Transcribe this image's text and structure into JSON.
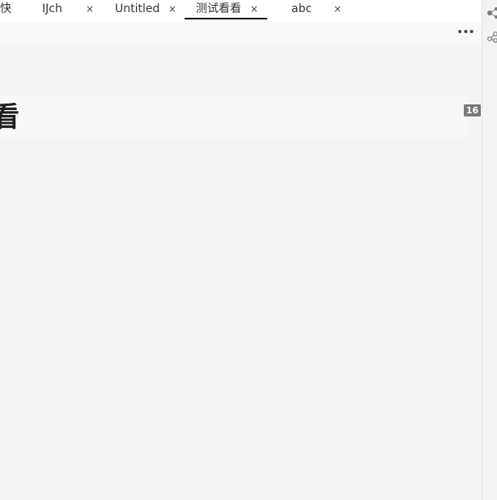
{
  "tabs": [
    {
      "label": "快",
      "closable": false,
      "active": false
    },
    {
      "label": "IJch",
      "close": "×",
      "active": false
    },
    {
      "label": "Untitled",
      "close": "×",
      "active": false
    },
    {
      "label": "测试看看",
      "close": "×",
      "active": true
    },
    {
      "label": "abc",
      "close": "×",
      "active": false
    }
  ],
  "toolbar": {
    "more_label": "•••",
    "more_icon": "ellipsis-icon"
  },
  "editor": {
    "heading_text": "看",
    "line_badge": "16"
  },
  "side_panel": {
    "icons": [
      "graph-icon",
      "share-nodes-icon"
    ]
  },
  "colors": {
    "background": "#f5f5f5",
    "active_tab_underline": "#000000",
    "badge": "#7a7a7a"
  }
}
